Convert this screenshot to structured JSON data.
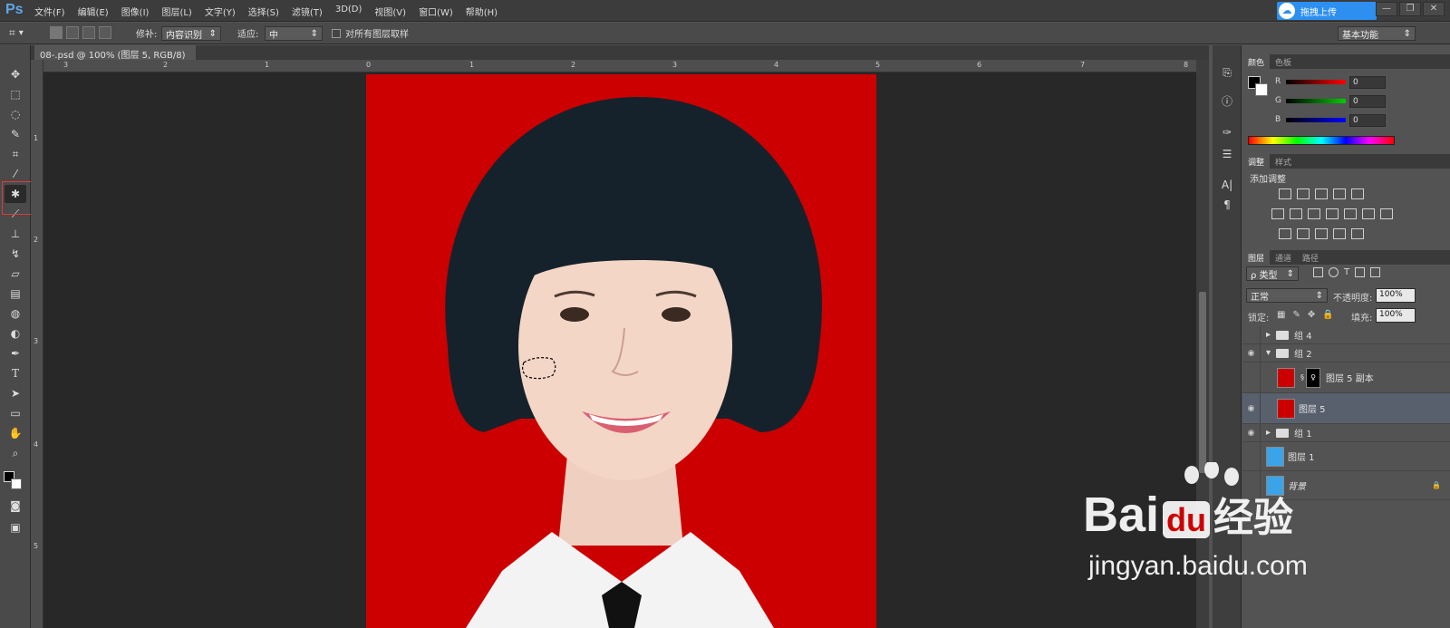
{
  "app": {
    "logo": "Ps"
  },
  "menu": [
    "文件(F)",
    "编辑(E)",
    "图像(I)",
    "图层(L)",
    "文字(Y)",
    "选择(S)",
    "滤镜(T)",
    "3D(D)",
    "视图(V)",
    "窗口(W)",
    "帮助(H)"
  ],
  "window_controls": {
    "minimize": "—",
    "restore": "❐",
    "close": "✕"
  },
  "upload_button": {
    "label": "拖拽上传"
  },
  "options": {
    "fill_label": "修补:",
    "fill_value": "内容识别",
    "adapt_label": "适应:",
    "adapt_value": "中",
    "sample_all_label": "对所有图层取样",
    "workspace_value": "基本功能"
  },
  "document": {
    "tab_title": "08-.psd @ 100% (图层 5, RGB/8) *",
    "close": "×"
  },
  "ruler": {
    "top": [
      "3",
      "2",
      "1",
      "0",
      "1",
      "2",
      "3",
      "4",
      "5",
      "6",
      "7",
      "8"
    ],
    "left": [
      "1",
      "2",
      "3",
      "4",
      "5"
    ]
  },
  "color_panel": {
    "tabs": [
      "颜色",
      "色板"
    ],
    "r_label": "R",
    "g_label": "G",
    "b_label": "B",
    "r_value": "0",
    "g_value": "0",
    "b_value": "0"
  },
  "adjust_panel": {
    "tabs": [
      "调整",
      "样式"
    ],
    "heading": "添加调整"
  },
  "layers_panel": {
    "tabs": [
      "图层",
      "通道",
      "路径"
    ],
    "filter_value": "ρ 类型",
    "blend_mode": "正常",
    "opacity_label": "不透明度:",
    "opacity_value": "100%",
    "lock_label": "锁定:",
    "fill_label": "填充:",
    "fill_value": "100%",
    "layers": [
      {
        "name": "组 4",
        "kind": "group",
        "visible": false,
        "expanded": false,
        "indent": 0
      },
      {
        "name": "组 2",
        "kind": "group",
        "visible": true,
        "expanded": true,
        "indent": 0
      },
      {
        "name": "图层 5 副本",
        "kind": "layer-mask",
        "visible": false,
        "indent": 1
      },
      {
        "name": "图层 5",
        "kind": "layer",
        "visible": true,
        "selected": true,
        "indent": 1
      },
      {
        "name": "组 1",
        "kind": "group",
        "visible": true,
        "expanded": false,
        "indent": 0
      },
      {
        "name": "图层 1",
        "kind": "layer-blue",
        "visible": false,
        "indent": 0
      },
      {
        "name": "背景",
        "kind": "background",
        "visible": false,
        "locked": true,
        "indent": 0
      }
    ]
  },
  "watermark": {
    "brand": "Bai",
    "brand2": "du",
    "product": "经验",
    "url": "jingyan.baidu.com"
  },
  "colors": {
    "accent": "#cc0000",
    "selection_highlight": "#58606e",
    "upload_blue": "#2d8ff0"
  }
}
